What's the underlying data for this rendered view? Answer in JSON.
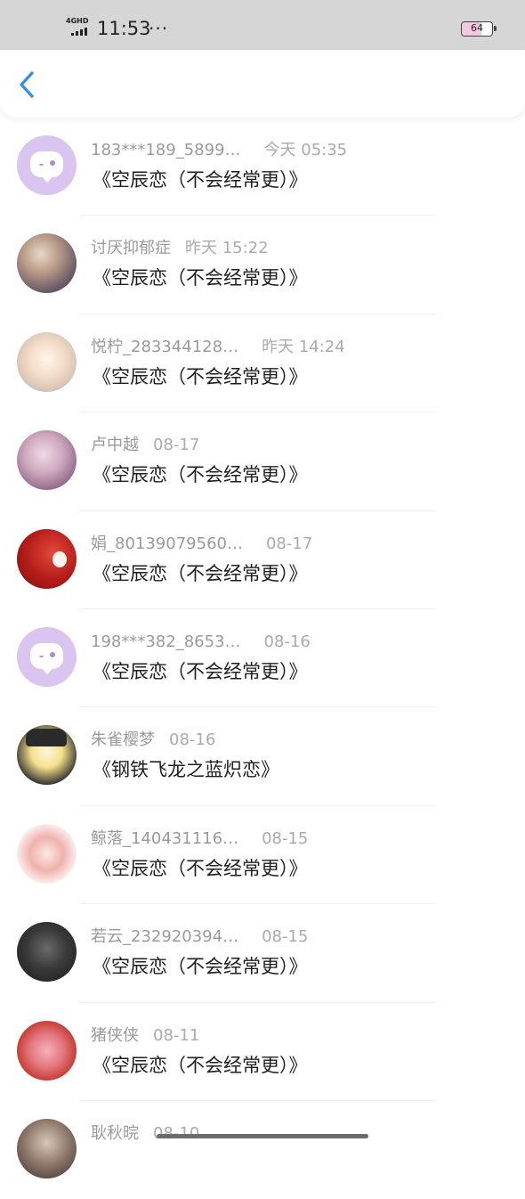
{
  "status_bar": {
    "network": "4GHD",
    "time": "11:53",
    "more": "···",
    "battery": "64"
  },
  "header": {
    "back_icon": "chevron-left-icon",
    "accent_color": "#2e8fea"
  },
  "items": [
    {
      "name": "183***189_5899…",
      "time": "今天  05:35",
      "title": "《空辰恋（不会经常更）》",
      "avatar": "chat-bubble-avatar"
    },
    {
      "name": "讨厌抑郁症",
      "time": "昨天  15:22",
      "title": "《空辰恋（不会经常更）》",
      "avatar": "user-photo-avatar"
    },
    {
      "name": "悦柠_283344128…",
      "time": "昨天  14:24",
      "title": "《空辰恋（不会经常更）》",
      "avatar": "user-photo-avatar"
    },
    {
      "name": "卢中越",
      "time": "08-17",
      "title": "《空辰恋（不会经常更）》",
      "avatar": "user-photo-avatar"
    },
    {
      "name": "娟_80139079560…",
      "time": "08-17",
      "title": "《空辰恋（不会经常更）》",
      "avatar": "user-photo-avatar"
    },
    {
      "name": "198***382_8653…",
      "time": "08-16",
      "title": "《空辰恋（不会经常更）》",
      "avatar": "chat-bubble-avatar"
    },
    {
      "name": "朱雀樱梦",
      "time": "08-16",
      "title": "《钢铁飞龙之蓝炽恋》",
      "avatar": "user-photo-avatar"
    },
    {
      "name": "鲸落_140431116…",
      "time": "08-15",
      "title": "《空辰恋（不会经常更）》",
      "avatar": "user-photo-avatar"
    },
    {
      "name": "若云_232920394…",
      "time": "08-15",
      "title": "《空辰恋（不会经常更）》",
      "avatar": "user-photo-avatar"
    },
    {
      "name": "猪侠侠",
      "time": "08-11",
      "title": "《空辰恋（不会经常更）》",
      "avatar": "user-photo-avatar"
    },
    {
      "name": "耿秋晥",
      "time": "08-10",
      "title": "",
      "avatar": "user-photo-avatar"
    }
  ]
}
